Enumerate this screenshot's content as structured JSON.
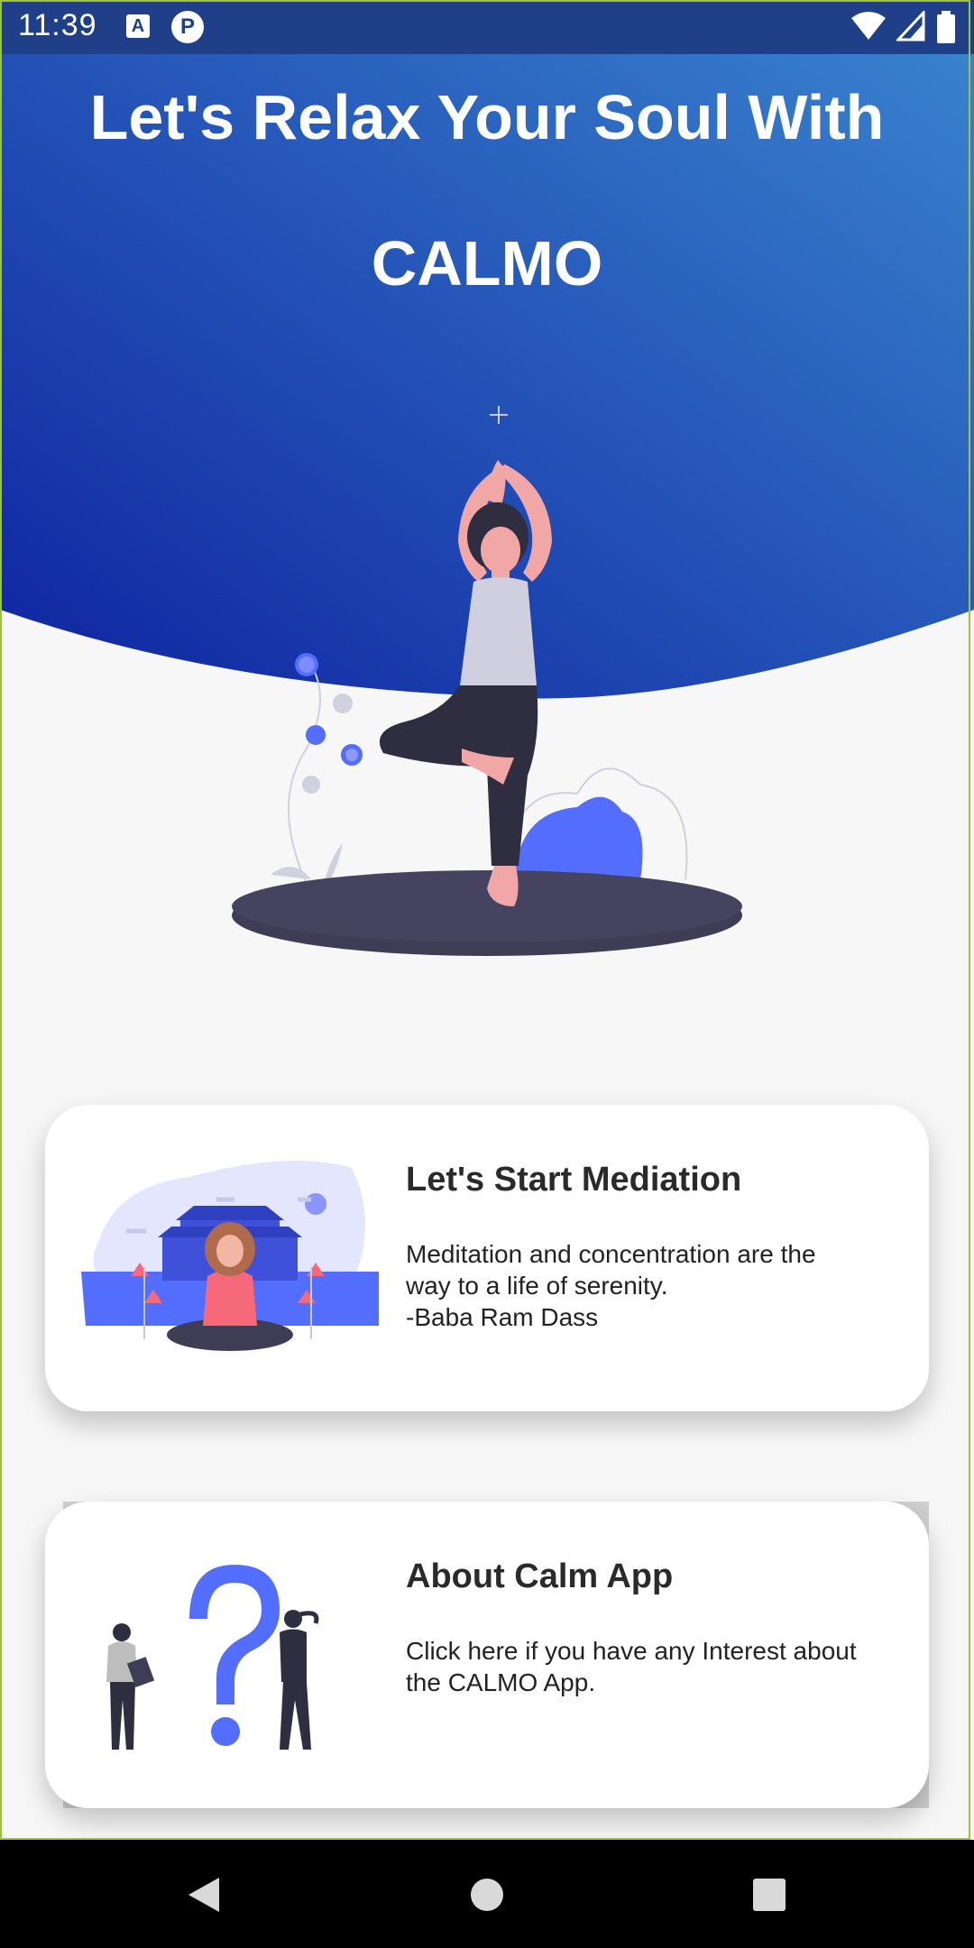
{
  "status_bar": {
    "time": "11:39",
    "icons": [
      "a-notification-icon",
      "p-notification-icon",
      "wifi-icon",
      "signal-icon",
      "battery-icon"
    ],
    "a_glyph": "A",
    "p_glyph": "P"
  },
  "hero": {
    "title_line1": "Let's Relax Your Soul With",
    "title_line2": "CALMO",
    "gradient_start": "#0f23a0",
    "gradient_end": "#3a86d0"
  },
  "cards": [
    {
      "title": "Let's Start Mediation",
      "text": "Meditation and concentration are the\nway to a life of serenity.\n-Baba Ram Dass",
      "image": "meditation-temple-illustration"
    },
    {
      "title": "About Calm App",
      "text": "Click here if you have any Interest about\nthe CALMO App.",
      "image": "question-mark-illustration"
    }
  ],
  "nav_bar": {
    "buttons": [
      "back-icon",
      "home-icon",
      "recents-icon"
    ]
  },
  "colors": {
    "accent": "#536dfe",
    "dark": "#3f3d56",
    "frame": "#9bc53d"
  }
}
